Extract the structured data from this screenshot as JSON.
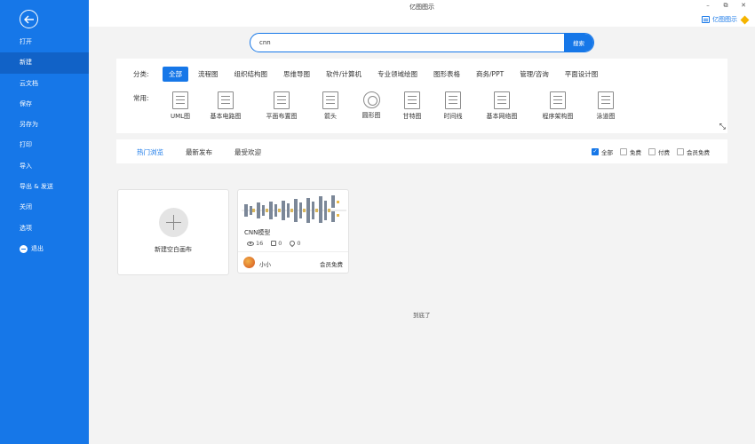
{
  "app": {
    "title": "亿图图示"
  },
  "window": {
    "minimize": "–",
    "restore": "⧉",
    "close": "✕"
  },
  "account": {
    "label": "亿图图示"
  },
  "sidebar": {
    "items": [
      {
        "label": "打开"
      },
      {
        "label": "新建"
      },
      {
        "label": "云文档"
      },
      {
        "label": "保存"
      },
      {
        "label": "另存为"
      },
      {
        "label": "打印"
      },
      {
        "label": "导入"
      },
      {
        "label": "导出 & 发送"
      },
      {
        "label": "关闭"
      },
      {
        "label": "选项"
      },
      {
        "label": "退出"
      }
    ],
    "active_index": 1
  },
  "search": {
    "value": "cnn",
    "button_label": "搜索"
  },
  "categories": {
    "label": "分类:",
    "items": [
      "全部",
      "流程图",
      "组织结构图",
      "思维导图",
      "软件/计算机",
      "专业领域绘图",
      "图形表格",
      "商务/PPT",
      "管理/咨询",
      "平面设计图"
    ],
    "active": "全部"
  },
  "common": {
    "label": "常用:",
    "items": [
      "UML图",
      "基本电路图",
      "平面布置图",
      "箭头",
      "圆形图",
      "甘特图",
      "时间线",
      "基本网络图",
      "程序架构图",
      "泳道图"
    ]
  },
  "tabs": {
    "items": [
      "热门浏览",
      "最新发布",
      "最受欢迎"
    ],
    "active": "热门浏览"
  },
  "filters": {
    "items": [
      {
        "label": "全部",
        "checked": true
      },
      {
        "label": "免费",
        "checked": false
      },
      {
        "label": "付费",
        "checked": false
      },
      {
        "label": "会员免费",
        "checked": false
      }
    ]
  },
  "new_card": {
    "label": "新建空白画布"
  },
  "template": {
    "title": "CNN模型",
    "views": "16",
    "likes": "0",
    "favorites": "0",
    "author": "小小",
    "price": "会员免费"
  },
  "footer": {
    "end_text": "到底了"
  },
  "colors": {
    "accent": "#1677e8",
    "sidebar_bg": "#1677e8",
    "sidebar_active": "#1162c7"
  }
}
